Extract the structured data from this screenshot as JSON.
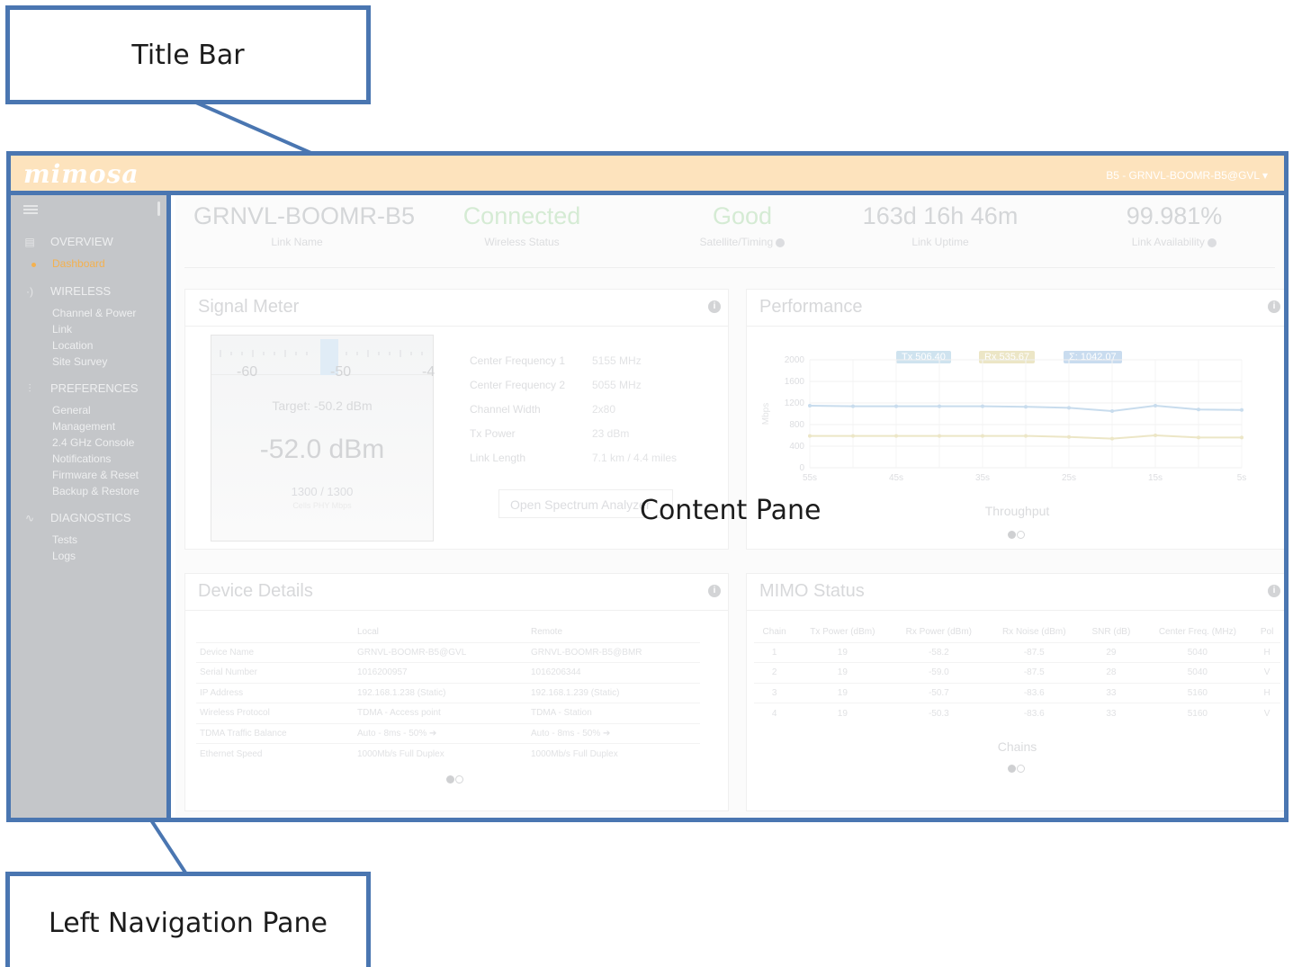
{
  "callouts": {
    "title_bar": "Title Bar",
    "left_nav": "Left Navigation Pane",
    "content_pane": "Content Pane"
  },
  "titlebar": {
    "logo": "mimosa",
    "device_menu": "B5 - GRNVL-BOOMR-B5@GVL ▾"
  },
  "sidebar": {
    "sections": [
      {
        "label": "OVERVIEW",
        "icon": "overview-icon",
        "items": [
          "Dashboard"
        ]
      },
      {
        "label": "WIRELESS",
        "icon": "wireless-icon",
        "items": [
          "Channel & Power",
          "Link",
          "Location",
          "Site Survey"
        ]
      },
      {
        "label": "PREFERENCES",
        "icon": "preferences-icon",
        "items": [
          "General",
          "Management",
          "2.4 GHz Console",
          "Notifications",
          "Firmware & Reset",
          "Backup & Restore"
        ]
      },
      {
        "label": "DIAGNOSTICS",
        "icon": "diagnostics-icon",
        "items": [
          "Tests",
          "Logs"
        ]
      }
    ],
    "active_item": "Dashboard",
    "accent_color": "#f4b14f"
  },
  "stats": [
    {
      "value": "GRNVL-BOOMR-B5",
      "label": "Link Name"
    },
    {
      "value": "Connected",
      "label": "Wireless Status"
    },
    {
      "value": "Good",
      "label": "Satellite/Timing"
    },
    {
      "value": "163d 16h 46m",
      "label": "Link Uptime"
    },
    {
      "value": "99.981%",
      "label": "Link Availability"
    }
  ],
  "signal_meter": {
    "title": "Signal Meter",
    "scale": [
      "-60",
      "-50",
      "-4"
    ],
    "target": "Target: -50.2 dBm",
    "reading": "-52.0 dBm",
    "rate": "1300 / 1300",
    "rate_sub": "Cells PHY Mbps",
    "fields": [
      {
        "label": "Center Frequency 1",
        "value": "5155 MHz"
      },
      {
        "label": "Center Frequency 2",
        "value": "5055 MHz"
      },
      {
        "label": "Channel Width",
        "value": "2x80"
      },
      {
        "label": "Tx Power",
        "value": "23 dBm"
      },
      {
        "label": "Link Length",
        "value": "7.1 km / 4.4 miles"
      }
    ],
    "button": "Open Spectrum Analyzer"
  },
  "performance": {
    "title": "Performance",
    "caption": "Throughput",
    "legend": [
      {
        "label": "Tx 506.40",
        "color": "#cfe3ef"
      },
      {
        "label": "Rx 535.67",
        "color": "#ece6c6"
      },
      {
        "label": "Σ: 1042.07",
        "color": "#c9dcef"
      }
    ]
  },
  "chart_data": {
    "type": "line",
    "title": "Throughput",
    "ylabel": "Mbps",
    "xlabel": "",
    "ylim": [
      0,
      2000
    ],
    "yticks": [
      "2000",
      "1600",
      "1200",
      "800",
      "400",
      "0"
    ],
    "x": [
      "55s",
      "50s",
      "45s",
      "40s",
      "35s",
      "30s",
      "25s",
      "20s",
      "15s",
      "10s",
      "5s"
    ],
    "xtick_labels": [
      "55s",
      "45s",
      "35s",
      "25s",
      "15s",
      "5s"
    ],
    "series": [
      {
        "name": "Total",
        "color": "#c8dced",
        "values": [
          1150,
          1140,
          1140,
          1140,
          1140,
          1130,
          1110,
          1050,
          1150,
          1080,
          1070
        ]
      },
      {
        "name": "Rx",
        "color": "#ece6c6",
        "values": [
          590,
          590,
          590,
          590,
          590,
          590,
          570,
          540,
          600,
          560,
          560
        ]
      }
    ]
  },
  "device_details": {
    "title": "Device Details",
    "columns": [
      "",
      "Local",
      "Remote"
    ],
    "rows": [
      [
        "Device Name",
        "GRNVL-BOOMR-B5@GVL",
        "GRNVL-BOOMR-B5@BMR"
      ],
      [
        "Serial Number",
        "1016200957",
        "1016206344"
      ],
      [
        "IP Address",
        "192.168.1.238 (Static)",
        "192.168.1.239 (Static)"
      ],
      [
        "Wireless Protocol",
        "TDMA - Access point",
        "TDMA - Station"
      ],
      [
        "TDMA Traffic Balance",
        "Auto - 8ms - 50% ➔",
        "Auto - 8ms - 50% ➔"
      ],
      [
        "Ethernet Speed",
        "1000Mb/s Full Duplex",
        "1000Mb/s Full Duplex"
      ]
    ]
  },
  "mimo_status": {
    "title": "MIMO Status",
    "caption": "Chains",
    "columns": [
      "Chain",
      "Tx Power (dBm)",
      "Rx Power (dBm)",
      "Rx Noise (dBm)",
      "SNR (dB)",
      "Center Freq. (MHz)",
      "Pol"
    ],
    "rows": [
      [
        "1",
        "19",
        "-58.2",
        "-87.5",
        "29",
        "5040",
        "H"
      ],
      [
        "2",
        "19",
        "-59.0",
        "-87.5",
        "28",
        "5040",
        "V"
      ],
      [
        "3",
        "19",
        "-50.7",
        "-83.6",
        "33",
        "5160",
        "H"
      ],
      [
        "4",
        "19",
        "-50.3",
        "-83.6",
        "33",
        "5160",
        "V"
      ]
    ]
  }
}
